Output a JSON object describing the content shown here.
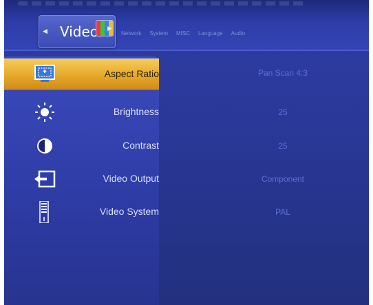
{
  "top_tabs": {
    "active": "Video",
    "others": [
      "Network",
      "System",
      "MISC",
      "Language",
      "Audio"
    ]
  },
  "menu": {
    "items": [
      {
        "label": "Aspect Ratio",
        "value": "Pan Scan 4:3",
        "icon": "aspect-ratio-icon"
      },
      {
        "label": "Brightness",
        "value": "25",
        "icon": "brightness-sun-icon"
      },
      {
        "label": "Contrast",
        "value": "25",
        "icon": "contrast-icon"
      },
      {
        "label": "Video Output",
        "value": "Component",
        "icon": "video-output-icon"
      },
      {
        "label": "Video System",
        "value": "PAL",
        "icon": "video-system-icon"
      }
    ]
  },
  "colors": {
    "background": "#2e3da8",
    "selected_row": "#e6a82a",
    "value_text": "#5c6fd6"
  }
}
